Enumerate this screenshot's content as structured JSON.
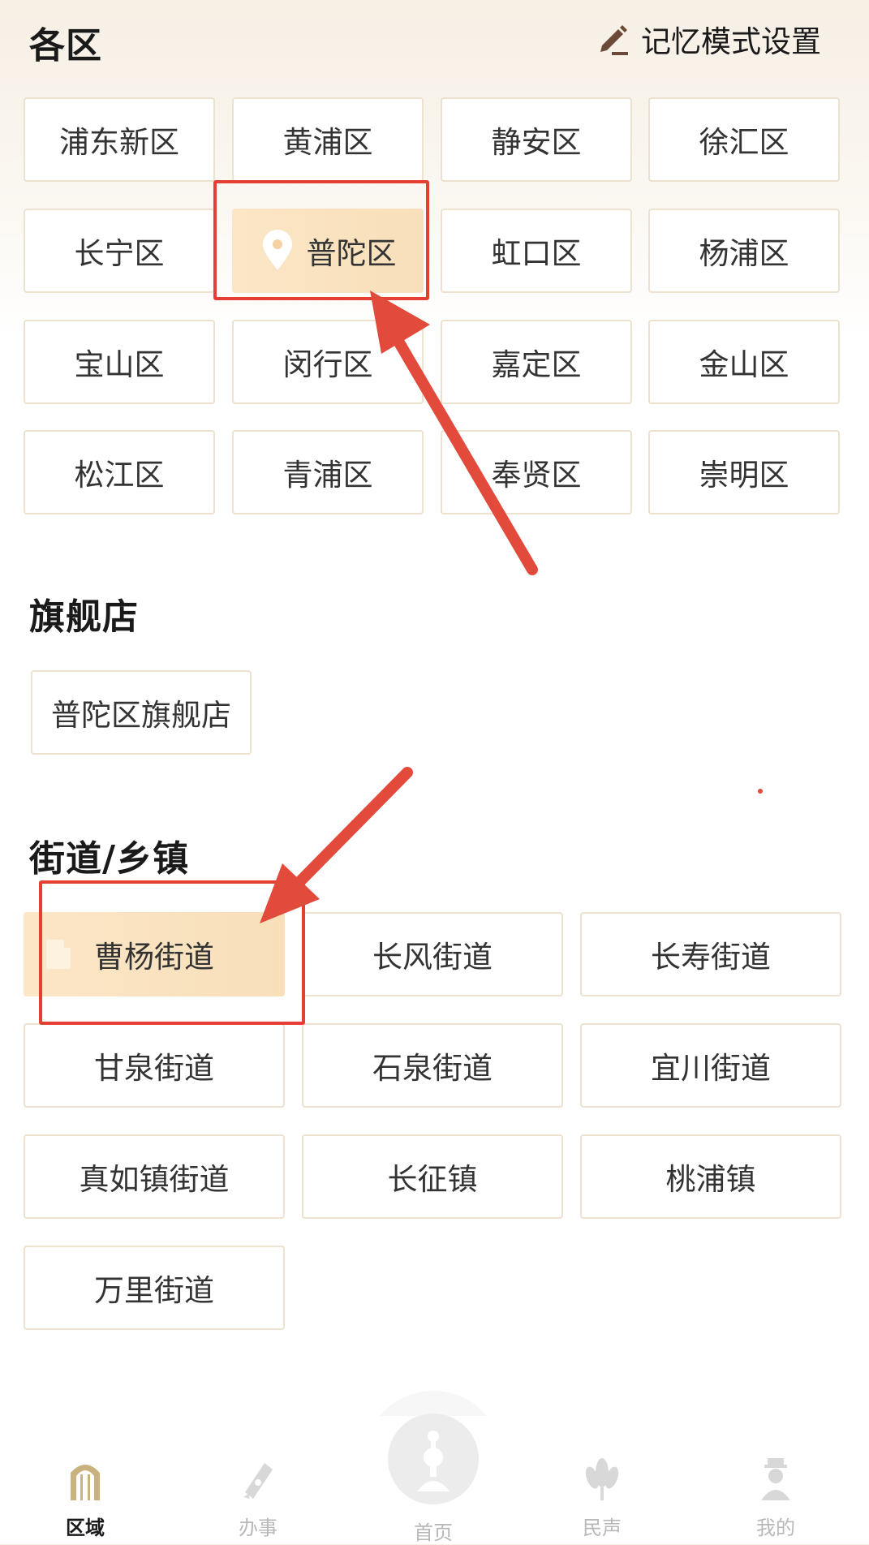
{
  "header": {
    "title": "各区",
    "memory_settings_label": "记忆模式设置",
    "memory_settings_icon": "edit-icon"
  },
  "districts": {
    "items": [
      "浦东新区",
      "黄浦区",
      "静安区",
      "徐汇区",
      "长宁区",
      "普陀区",
      "虹口区",
      "杨浦区",
      "宝山区",
      "闵行区",
      "嘉定区",
      "金山区",
      "松江区",
      "青浦区",
      "奉贤区",
      "崇明区"
    ],
    "selected": "普陀区",
    "selected_icon": "location-pin-icon"
  },
  "flagship": {
    "title": "旗舰店",
    "items": [
      "普陀区旗舰店"
    ]
  },
  "streets": {
    "title": "街道/乡镇",
    "items": [
      "曹杨街道",
      "长风街道",
      "长寿街道",
      "甘泉街道",
      "石泉街道",
      "宜川街道",
      "真如镇街道",
      "长征镇",
      "桃浦镇",
      "万里街道"
    ],
    "selected": "曹杨街道",
    "selected_icon": "document-icon"
  },
  "bottom_nav": {
    "items": [
      {
        "label": "区域",
        "icon": "region-arch-icon",
        "active": true
      },
      {
        "label": "办事",
        "icon": "pen-nib-icon",
        "active": false
      },
      {
        "label": "首页",
        "icon": "home-logo-icon",
        "active": false
      },
      {
        "label": "民声",
        "icon": "flower-icon",
        "active": false
      },
      {
        "label": "我的",
        "icon": "user-icon",
        "active": false
      }
    ]
  },
  "colors": {
    "accent_selected": "#f8dfba",
    "annotation_red": "#e53e33",
    "border": "#ece2cf"
  }
}
